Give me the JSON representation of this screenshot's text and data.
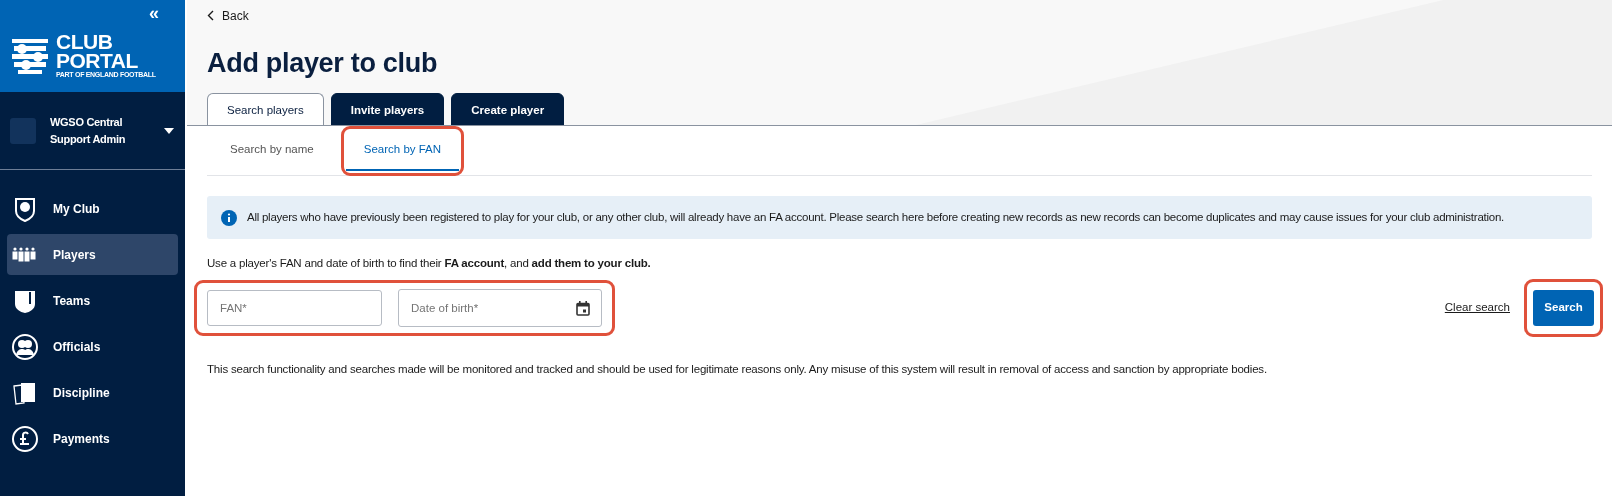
{
  "sidebar": {
    "collapse_icon": "«",
    "brand": {
      "line1": "CLUB",
      "line2": "PORTAL",
      "tagline": "PART OF ENGLAND FOOTBALL"
    },
    "user": {
      "name": "WGSO Central Support Admin"
    },
    "items": [
      {
        "label": "My Club",
        "kind": "crest",
        "selected": false
      },
      {
        "label": "Players",
        "kind": "players",
        "selected": true
      },
      {
        "label": "Teams",
        "kind": "shield",
        "selected": false
      },
      {
        "label": "Officials",
        "kind": "officials",
        "selected": false
      },
      {
        "label": "Discipline",
        "kind": "cards",
        "selected": false
      },
      {
        "label": "Payments",
        "kind": "pound",
        "selected": false
      }
    ]
  },
  "back": "Back",
  "title": "Add player to club",
  "tabs": [
    {
      "label": "Search players",
      "selected": true
    },
    {
      "label": "Invite players",
      "selected": false
    },
    {
      "label": "Create player",
      "selected": false
    }
  ],
  "subtabs": [
    {
      "label": "Search by name",
      "selected": false,
      "highlighted": false
    },
    {
      "label": "Search by FAN",
      "selected": true,
      "highlighted": true
    }
  ],
  "info": "All players who have previously been registered to play for your club, or any other club, will already have an FA account. Please search here before creating new records as new records can become duplicates and may cause issues for your club administration.",
  "instruction": "Use a player's FAN and date of birth to find their **FA account**, and **add them to your club.**",
  "fields": {
    "highlighted": true,
    "items": [
      {
        "placeholder": "FAN*",
        "kind": "text"
      },
      {
        "placeholder": "Date of birth*",
        "kind": "date"
      }
    ]
  },
  "clear_link": "Clear search",
  "search_button": {
    "label": "Search",
    "highlighted": true
  },
  "disclaimer": "This search functionality and searches made will be monitored and tracked and should be used for legitimate reasons only. Any misuse of this system will result in removal of access and sanction by appropriate bodies."
}
